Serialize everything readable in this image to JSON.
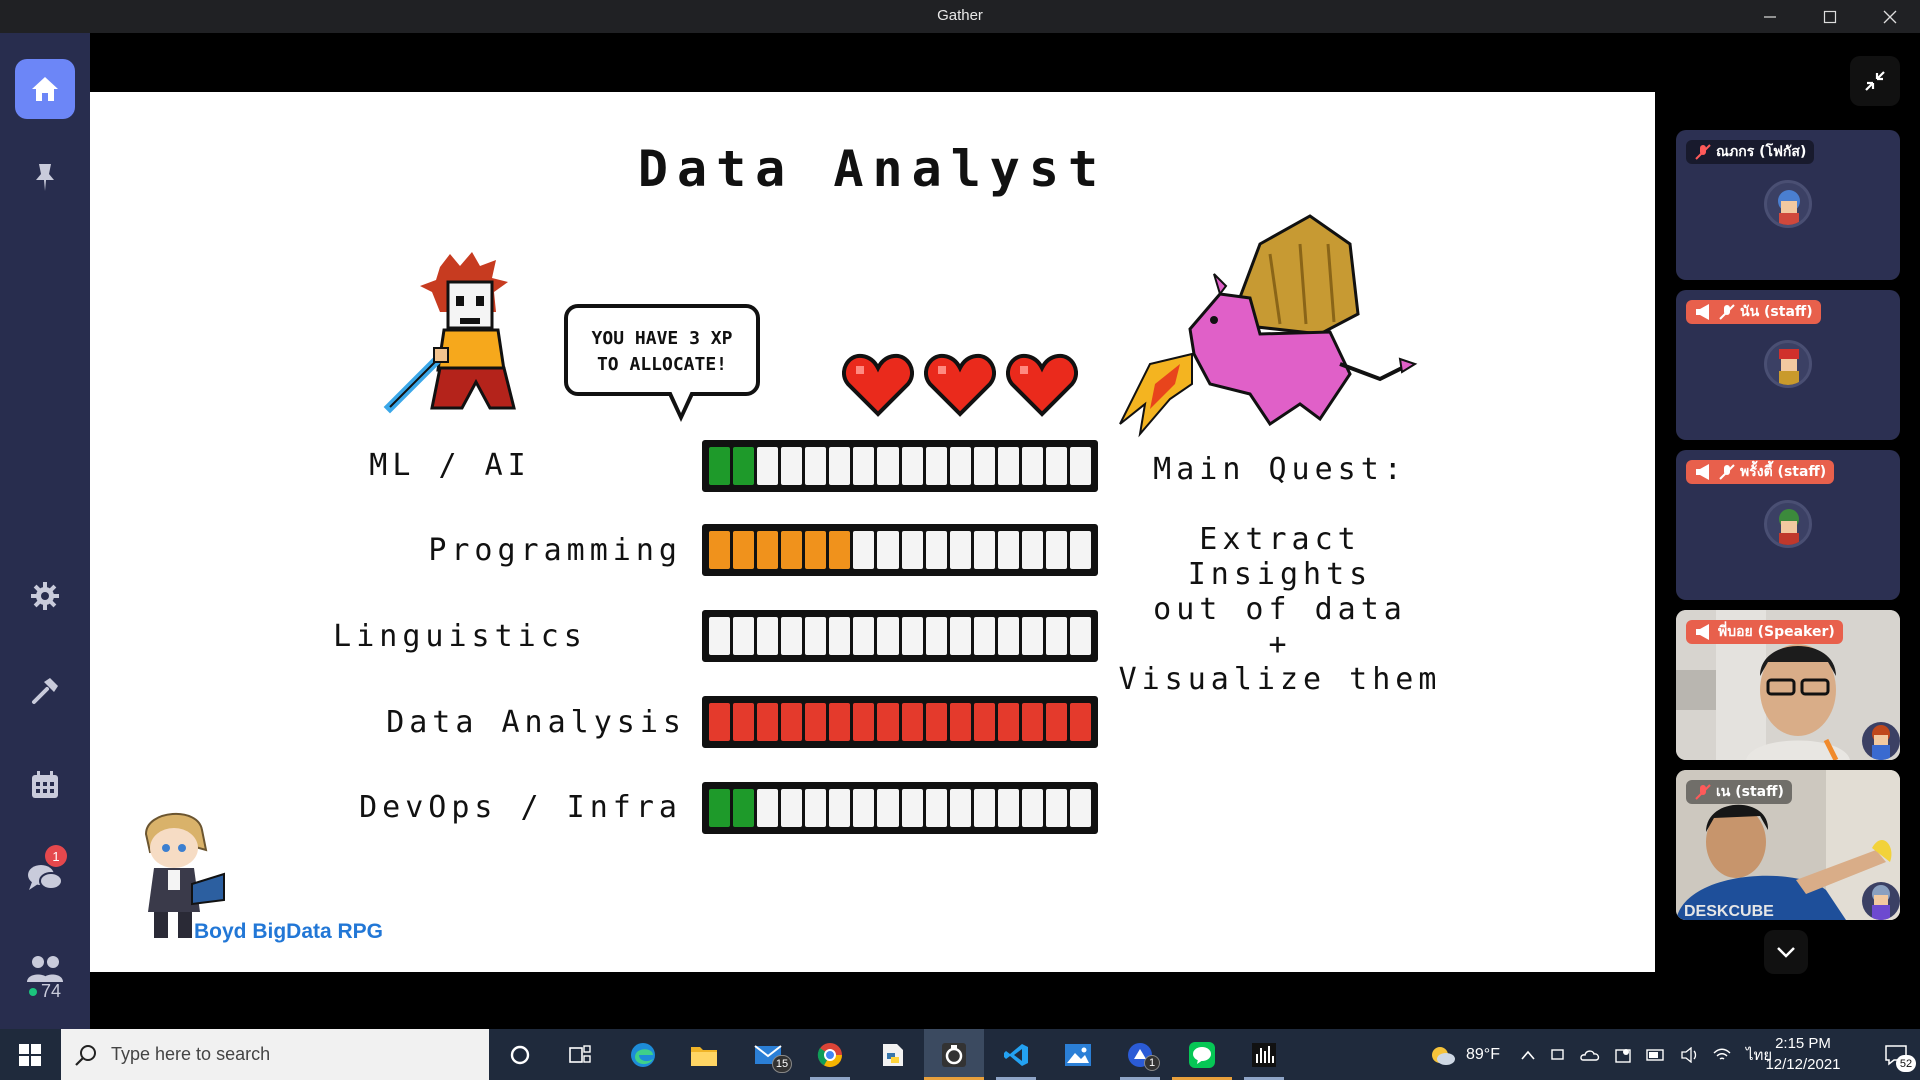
{
  "window": {
    "title": "Gather",
    "minimize": "—",
    "maximize": "☐",
    "close": "✕"
  },
  "sidebar": {
    "chat_badge": "1",
    "online_count": "74",
    "icons": [
      "home-icon",
      "pin-icon",
      "gear-icon",
      "hammer-icon",
      "calendar-icon",
      "chat-icon",
      "people-icon"
    ]
  },
  "slide": {
    "title": "Data Analyst",
    "speech": "YOU HAVE 3 XP\nTO ALLOCATE!",
    "hearts": 3,
    "skills": [
      {
        "label": "ML / AI",
        "filled": 2,
        "total": 16,
        "color": "#1e9a2a"
      },
      {
        "label": "Programming",
        "filled": 6,
        "total": 16,
        "color": "#f0921c"
      },
      {
        "label": "Linguistics",
        "filled": 0,
        "total": 16,
        "color": "#ffffff"
      },
      {
        "label": "Data Analysis",
        "filled": 16,
        "total": 16,
        "color": "#e43a2c"
      },
      {
        "label": "DevOps / Infra",
        "filled": 2,
        "total": 16,
        "color": "#1e9a2a"
      }
    ],
    "quest_heading": "Main Quest:",
    "quest_body": "Extract\nInsights\nout of data\n+\nVisualize them",
    "brand": "Boyd BigData RPG"
  },
  "participants": [
    {
      "name": "ณภกร (โฟกัส)",
      "speaker": false,
      "muted": true,
      "video": false
    },
    {
      "name": "นัน (staff)",
      "speaker": true,
      "muted": true,
      "video": false
    },
    {
      "name": "พรั้งตี้ (staff)",
      "speaker": true,
      "muted": true,
      "video": false
    },
    {
      "name": "พี่บอย (Speaker)",
      "speaker": true,
      "muted": false,
      "video": true
    },
    {
      "name": "เน (staff)",
      "speaker": false,
      "muted": true,
      "video": true
    }
  ],
  "taskbar": {
    "search_placeholder": "Type here to search",
    "mail_badge": "15",
    "app_badge": "1",
    "temperature": "89°F",
    "language": "ไทย",
    "time": "2:15 PM",
    "date": "12/12/2021",
    "notification_count": "52"
  },
  "colors": {
    "sidebar": "#282d4e",
    "accent": "#6c86f7",
    "speaker_label": "#e8604c",
    "taskbar": "#1f2a3c"
  }
}
